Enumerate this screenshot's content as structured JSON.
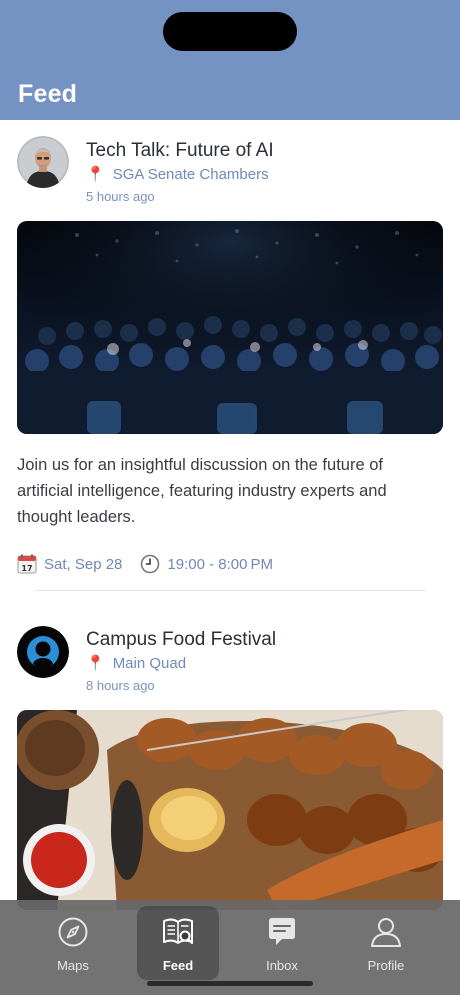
{
  "header": {
    "title": "Feed"
  },
  "posts": [
    {
      "title": "Tech Talk: Future of AI",
      "location": "SGA Senate Chambers",
      "time": "5 hours ago",
      "description": "Join us for an insightful discussion on the future of artificial intelligence, featuring industry experts and thought leaders.",
      "date": "Sat, Sep 28",
      "hours": "19:00 - 8:00 PM"
    },
    {
      "title": "Campus Food Festival",
      "location": "Main Quad",
      "time": "8 hours ago"
    }
  ],
  "tabs": [
    {
      "label": "Maps",
      "icon": "compass-icon",
      "active": false
    },
    {
      "label": "Feed",
      "icon": "newspaper-search-icon",
      "active": true
    },
    {
      "label": "Inbox",
      "icon": "chat-bubble-icon",
      "active": false
    },
    {
      "label": "Profile",
      "icon": "person-icon",
      "active": false
    }
  ],
  "colors": {
    "header": "#7493c3",
    "accent_text": "#6f8bb8",
    "tabbar": "#686868"
  }
}
